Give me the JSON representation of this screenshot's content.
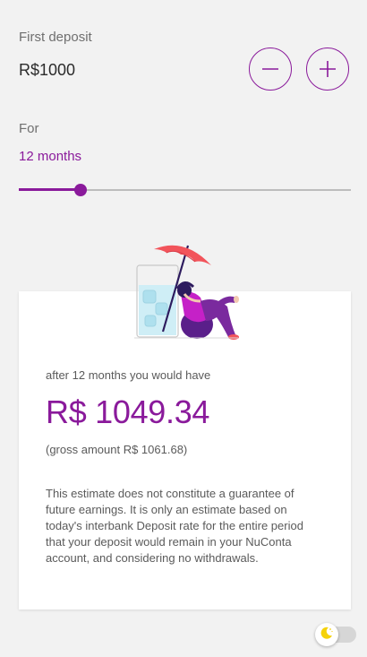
{
  "deposit": {
    "label": "First deposit",
    "value": "R$1000",
    "decrease_icon": "minus-icon",
    "increase_icon": "plus-icon"
  },
  "period": {
    "label": "For",
    "value": "12 months",
    "slider_fraction": 0.185
  },
  "illustration": {
    "icon": "person-relaxing-under-umbrella-illustration"
  },
  "result": {
    "after_text": "after 12 months you would have",
    "amount": "R$ 1049.34",
    "gross_text": "(gross amount R$ 1061.68)",
    "disclaimer": "This estimate does not constitute a guarantee of future earnings. It is only an estimate based on today's interbank Deposit rate for the entire period that your deposit would remain in your NuConta account, and considering no withdrawals."
  },
  "theme_toggle": {
    "icon": "moon-icon",
    "state": "off"
  },
  "colors": {
    "accent": "#8a1a9b",
    "background": "#f2f2f2",
    "card": "#ffffff",
    "umbrella": "#f2545b",
    "toggle_icon": "#f5d20a"
  }
}
